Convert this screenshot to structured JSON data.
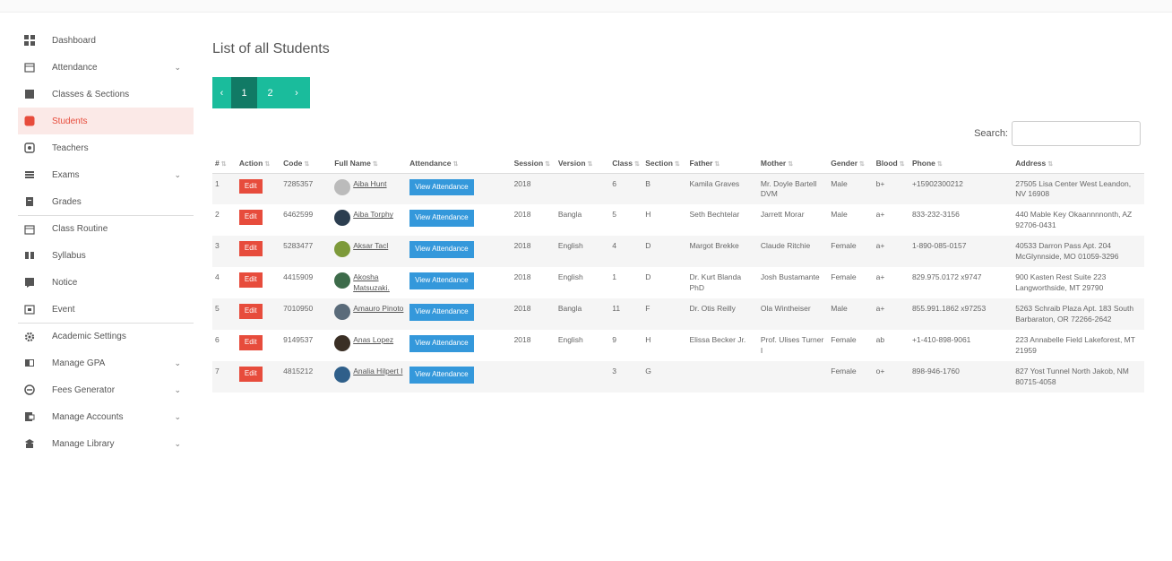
{
  "sidebar": {
    "items": [
      {
        "label": "Dashboard",
        "icon": "dashboard-icon",
        "chevron": false
      },
      {
        "label": "Attendance",
        "icon": "calendar-icon",
        "chevron": true
      },
      {
        "label": "Classes & Sections",
        "icon": "book-icon",
        "chevron": false
      },
      {
        "label": "Students",
        "icon": "student-icon",
        "chevron": false,
        "active": true
      },
      {
        "label": "Teachers",
        "icon": "teacher-icon",
        "chevron": false
      },
      {
        "label": "Exams",
        "icon": "list-icon",
        "chevron": true
      },
      {
        "label": "Grades",
        "icon": "grade-icon",
        "chevron": false
      },
      {
        "label": "Class Routine",
        "icon": "calendar-icon",
        "chevron": false,
        "sep": true
      },
      {
        "label": "Syllabus",
        "icon": "columns-icon",
        "chevron": false
      },
      {
        "label": "Notice",
        "icon": "notice-icon",
        "chevron": false
      },
      {
        "label": "Event",
        "icon": "event-icon",
        "chevron": false
      },
      {
        "label": "Academic Settings",
        "icon": "gear-icon",
        "chevron": false,
        "sep": true
      },
      {
        "label": "Manage GPA",
        "icon": "gpa-icon",
        "chevron": true
      },
      {
        "label": "Fees Generator",
        "icon": "fees-icon",
        "chevron": true
      },
      {
        "label": "Manage Accounts",
        "icon": "accounts-icon",
        "chevron": true
      },
      {
        "label": "Manage Library",
        "icon": "library-icon",
        "chevron": true
      }
    ]
  },
  "main": {
    "title": "List of all Students",
    "pager": {
      "prev": "‹",
      "pages": [
        "1",
        "2"
      ],
      "next": "›"
    },
    "search_label": "Search:",
    "columns": [
      "#",
      "Action",
      "Code",
      "Full Name",
      "Attendance",
      "Session",
      "Version",
      "Class",
      "Section",
      "Father",
      "Mother",
      "Gender",
      "Blood",
      "Phone",
      "Address"
    ],
    "edit_label": "Edit",
    "attendance_label": "View Attendance",
    "rows": [
      {
        "num": "1",
        "code": "7285357",
        "name": "Aiba Hunt",
        "avatar": "#bbbbbb",
        "session": "2018",
        "version": "",
        "class": "6",
        "section": "B",
        "father": "Kamila Graves",
        "mother": "Mr. Doyle Bartell DVM",
        "gender": "Male",
        "blood": "b+",
        "phone": "+15902300212",
        "address": "27505 Lisa Center West Leandon, NV 16908"
      },
      {
        "num": "2",
        "code": "6462599",
        "name": "Aiba Torphy",
        "avatar": "#2c3e50",
        "session": "2018",
        "version": "Bangla",
        "class": "5",
        "section": "H",
        "father": "Seth Bechtelar",
        "mother": "Jarrett Morar",
        "gender": "Male",
        "blood": "a+",
        "phone": "833-232-3156",
        "address": "440 Mable Key Okaannnnonth, AZ 92706-0431"
      },
      {
        "num": "3",
        "code": "5283477",
        "name": "Aksar Tacl",
        "avatar": "#7d9a3a",
        "session": "2018",
        "version": "English",
        "class": "4",
        "section": "D",
        "father": "Margot Brekke",
        "mother": "Claude Ritchie",
        "gender": "Female",
        "blood": "a+",
        "phone": "1-890-085-0157",
        "address": "40533 Darron Pass Apt. 204 McGlynnside, MO 01059-3296"
      },
      {
        "num": "4",
        "code": "4415909",
        "name": "Akosha Matsuzaki.",
        "avatar": "#3d6b4a",
        "session": "2018",
        "version": "English",
        "class": "1",
        "section": "D",
        "father": "Dr. Kurt Blanda PhD",
        "mother": "Josh Bustamante",
        "gender": "Female",
        "blood": "a+",
        "phone": "829.975.0172 x9747",
        "address": "900 Kasten Rest Suite 223 Langworthside, MT 29790"
      },
      {
        "num": "5",
        "code": "7010950",
        "name": "Amauro Pinoto",
        "avatar": "#5a6b7a",
        "session": "2018",
        "version": "Bangla",
        "class": "11",
        "section": "F",
        "father": "Dr. Otis Reilly",
        "mother": "Ola Wintheiser",
        "gender": "Male",
        "blood": "a+",
        "phone": "855.991.1862 x97253",
        "address": "5263 Schraib Plaza Apt. 183 South Barbaraton, OR 72266-2642"
      },
      {
        "num": "6",
        "code": "9149537",
        "name": "Anas Lopez",
        "avatar": "#3a2f25",
        "session": "2018",
        "version": "English",
        "class": "9",
        "section": "H",
        "father": "Elissa Becker Jr.",
        "mother": "Prof. Ulises Turner I",
        "gender": "Female",
        "blood": "ab",
        "phone": "+1-410-898-9061",
        "address": "223 Annabelle Field Lakeforest, MT 21959"
      },
      {
        "num": "7",
        "code": "4815212",
        "name": "Analia Hilpert I",
        "avatar": "#2f5f8a",
        "session": "",
        "version": "",
        "class": "3",
        "section": "G",
        "father": "",
        "mother": "",
        "gender": "Female",
        "blood": "o+",
        "phone": "898-946-1760",
        "address": "827 Yost Tunnel North Jakob, NM 80715-4058"
      }
    ]
  }
}
